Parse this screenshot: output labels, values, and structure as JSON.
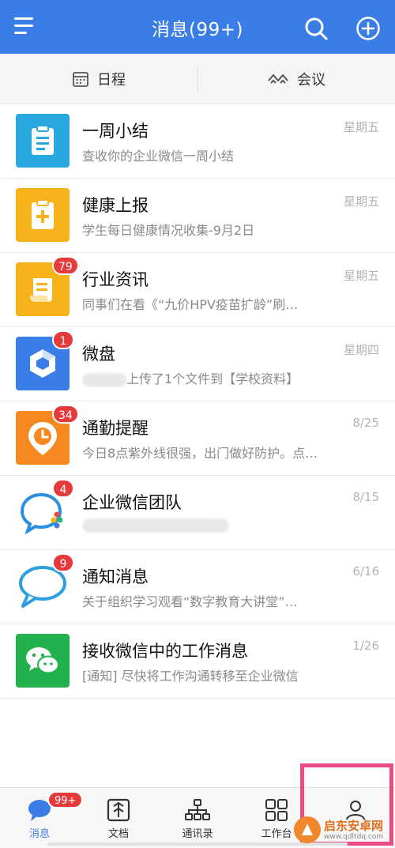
{
  "header": {
    "title": "消息(99+)",
    "bg_color": "#3a7de6",
    "menu_icon": "menu-icon",
    "search_icon": "search-icon",
    "add_icon": "add-circle-icon"
  },
  "subtabs": [
    {
      "label": "日程",
      "icon": "calendar-icon"
    },
    {
      "label": "会议",
      "icon": "meeting-icon"
    }
  ],
  "messages": [
    {
      "name": "一周小结",
      "preview": "查收你的企业微信一周小结",
      "time": "星期五",
      "badge": "",
      "icon": "clipboard-icon",
      "color": "#29a8e0"
    },
    {
      "name": "健康上报",
      "preview": "学生每日健康情况收集-9月2日",
      "time": "星期五",
      "badge": "",
      "icon": "health-report-icon",
      "color": "#f5b21b"
    },
    {
      "name": "行业资讯",
      "preview": "同事们在看《“九价HPV疫苗扩龄”刷…",
      "time": "星期五",
      "badge": "79",
      "icon": "news-icon",
      "color": "#f5b21b"
    },
    {
      "name": "微盘",
      "preview": "上传了1个文件到【学校资料】",
      "time": "星期四",
      "badge": "1",
      "icon": "cloud-drive-icon",
      "color": "#3a7de6"
    },
    {
      "name": "通勤提醒",
      "preview": "今日8点紫外线很强，出门做好防护。点…",
      "time": "8/25",
      "badge": "34",
      "icon": "clock-icon",
      "color": "#f5881f"
    },
    {
      "name": "企业微信团队",
      "preview": "",
      "time": "8/15",
      "badge": "4",
      "icon": "wecom-team-icon",
      "color": "#ffffff"
    },
    {
      "name": "通知消息",
      "preview": "关于组织学习观看“数字教育大讲堂”…",
      "time": "6/16",
      "badge": "9",
      "icon": "chat-bubble-icon",
      "color": "#ffffff"
    },
    {
      "name": "接收微信中的工作消息",
      "preview": "[通知] 尽快将工作沟通转移至企业微信",
      "time": "1/26",
      "badge": "",
      "icon": "wechat-icon",
      "color": "#22b14c"
    }
  ],
  "bottom_nav": [
    {
      "label": "消息",
      "icon": "messages-icon",
      "badge": "99+",
      "active": true
    },
    {
      "label": "文档",
      "icon": "document-icon"
    },
    {
      "label": "通讯录",
      "icon": "contacts-icon"
    },
    {
      "label": "工作台",
      "icon": "workbench-icon"
    },
    {
      "label": "",
      "icon": "me-icon"
    }
  ],
  "bottom_nav_visible_labels": [
    "消息",
    "文档",
    "通讯录",
    "工作台"
  ],
  "highlight_color": "#e94b86",
  "watermark": {
    "name": "启东安卓网",
    "url": "www.qdltdq.com"
  }
}
